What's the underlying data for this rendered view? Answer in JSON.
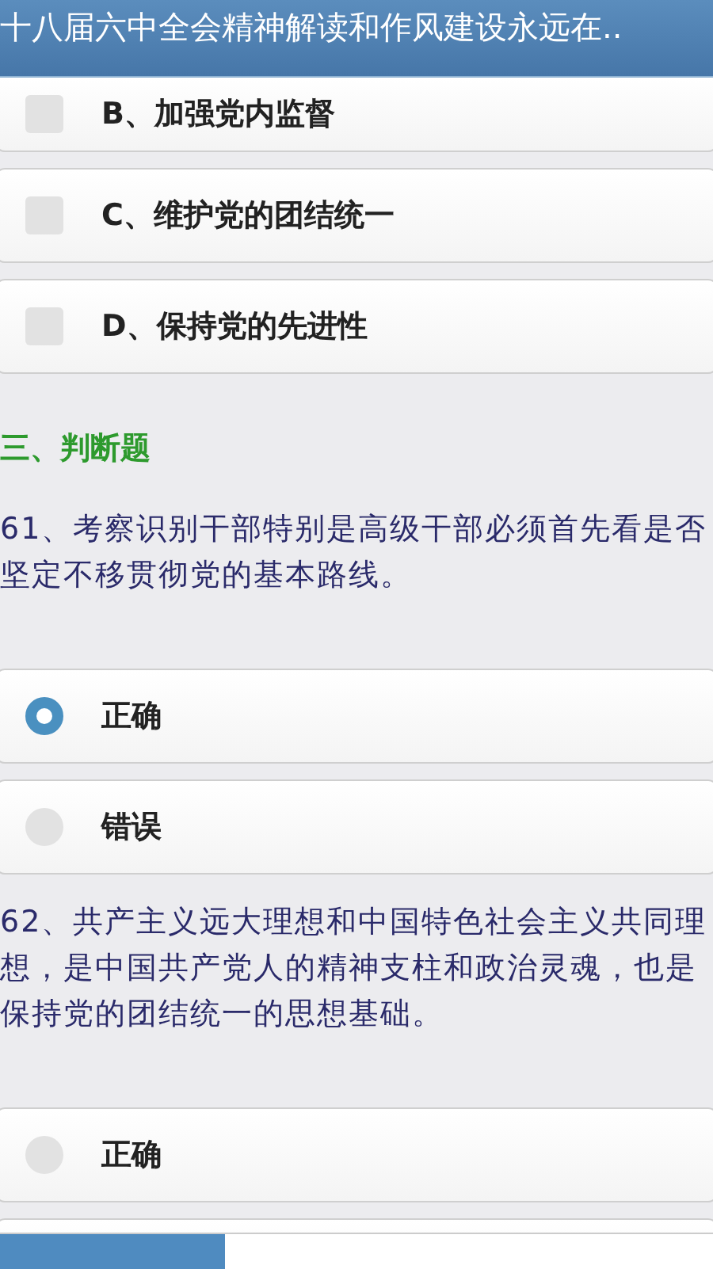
{
  "header": {
    "title": "十八届六中全会精神解读和作风建设永远在.."
  },
  "choice_options": [
    {
      "label": "B、加强党内监督",
      "checked": false
    },
    {
      "label": "C、维护党的团结统一",
      "checked": false
    },
    {
      "label": "D、保持党的先进性",
      "checked": false
    }
  ],
  "section_title": "三、判断题",
  "judgments": [
    {
      "text": "61、考察识别干部特别是高级干部必须首先看是否坚定不移贯彻党的基本路线。",
      "options": [
        {
          "label": "正确",
          "selected": true
        },
        {
          "label": "错误",
          "selected": false
        }
      ]
    },
    {
      "text": "62、共产主义远大理想和中国特色社会主义共同理想，是中国共产党人的精神支柱和政治灵魂，也是保持党的团结统一的思想基础。",
      "options": [
        {
          "label": "正确",
          "selected": false
        }
      ]
    }
  ],
  "bottom_tabs": [
    {
      "selected": true
    },
    {
      "selected": false
    }
  ]
}
